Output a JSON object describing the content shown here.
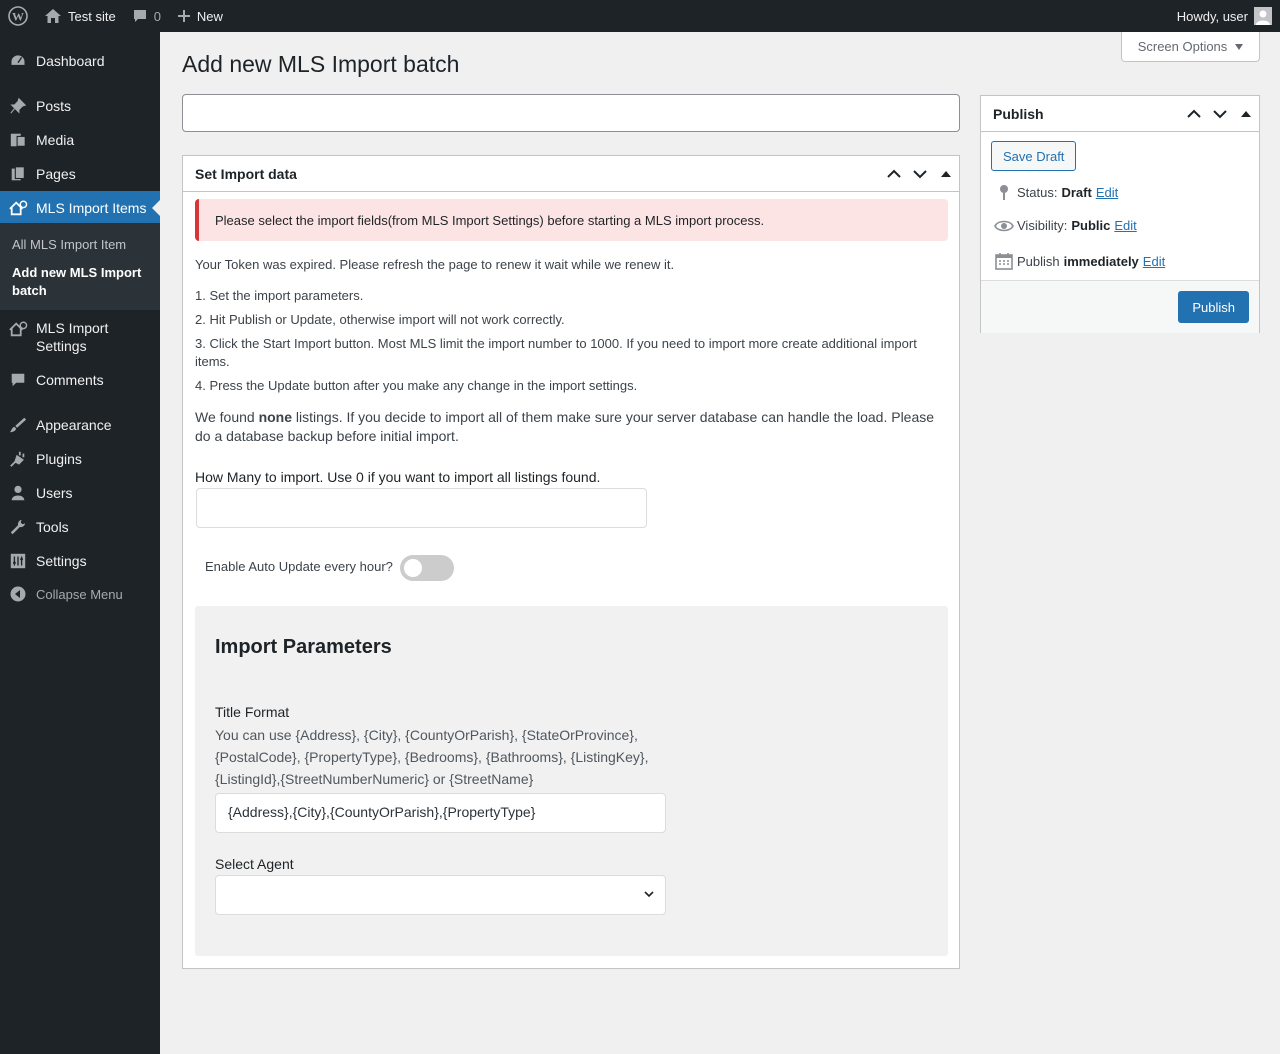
{
  "adminbar": {
    "site_name": "Test site",
    "comments_count": "0",
    "new_label": "New",
    "howdy": "Howdy, user"
  },
  "sidebar": {
    "items": [
      {
        "label": "Dashboard",
        "icon": "dashboard-icon"
      },
      {
        "label": "Posts",
        "icon": "pin-icon"
      },
      {
        "label": "Media",
        "icon": "media-icon"
      },
      {
        "label": "Pages",
        "icon": "pages-icon"
      },
      {
        "label": "MLS Import Items",
        "icon": "house-cloud-icon"
      },
      {
        "label": "MLS Import Settings",
        "icon": "house-cloud-icon"
      },
      {
        "label": "Comments",
        "icon": "comment-icon"
      },
      {
        "label": "Appearance",
        "icon": "brush-icon"
      },
      {
        "label": "Plugins",
        "icon": "plugin-icon"
      },
      {
        "label": "Users",
        "icon": "user-icon"
      },
      {
        "label": "Tools",
        "icon": "wrench-icon"
      },
      {
        "label": "Settings",
        "icon": "settings-icon"
      }
    ],
    "submenu": [
      "All MLS Import Item",
      "Add new MLS Import batch"
    ],
    "collapse_label": "Collapse Menu"
  },
  "screen_options_label": "Screen Options",
  "page_title": "Add new MLS Import batch",
  "import_box": {
    "title": "Set Import data",
    "notice": "Please select the import fields(from MLS Import Settings) before starting a MLS import process.",
    "token_msg": "Your Token was expired. Please refresh the page to renew it wait while we renew it.",
    "steps": [
      "1. Set the import parameters.",
      "2. Hit Publish or Update, otherwise import will not work correctly.",
      "3. Click the Start Import button. Most MLS limit the import number to 1000. If you need to import more create additional import items.",
      "4. Press the Update button after you make any change in the import settings."
    ],
    "found_pre": "We found ",
    "found_count": "none",
    "found_post": " listings. If you decide to import all of them make sure your server database can handle the load. Please do a database backup before initial import.",
    "how_many_label": "How Many to import. Use 0 if you want to import all listings found.",
    "how_many_value": "",
    "auto_update_label": "Enable Auto Update every hour?",
    "auto_update_on": false,
    "params": {
      "heading": "Import Parameters",
      "title_format_label": "Title Format",
      "title_format_help": "You can use {Address}, {City}, {CountyOrParish}, {StateOrProvince}, {PostalCode}, {PropertyType}, {Bedrooms}, {Bathrooms}, {ListingKey}, {ListingId},{StreetNumberNumeric} or {StreetName}",
      "title_format_value": "{Address},{City},{CountyOrParish},{PropertyType}",
      "select_agent_label": "Select Agent",
      "select_agent_value": ""
    }
  },
  "publish_box": {
    "title": "Publish",
    "save_draft": "Save Draft",
    "status_label": "Status:",
    "status_value": "Draft",
    "visibility_label": "Visibility:",
    "visibility_value": "Public",
    "publish_label": "Publish",
    "publish_value": "immediately",
    "edit_label": "Edit",
    "publish_button": "Publish"
  },
  "colors": {
    "accent": "#2271b1",
    "sidebar_bg": "#1d2327",
    "notice_border": "#d63638"
  }
}
